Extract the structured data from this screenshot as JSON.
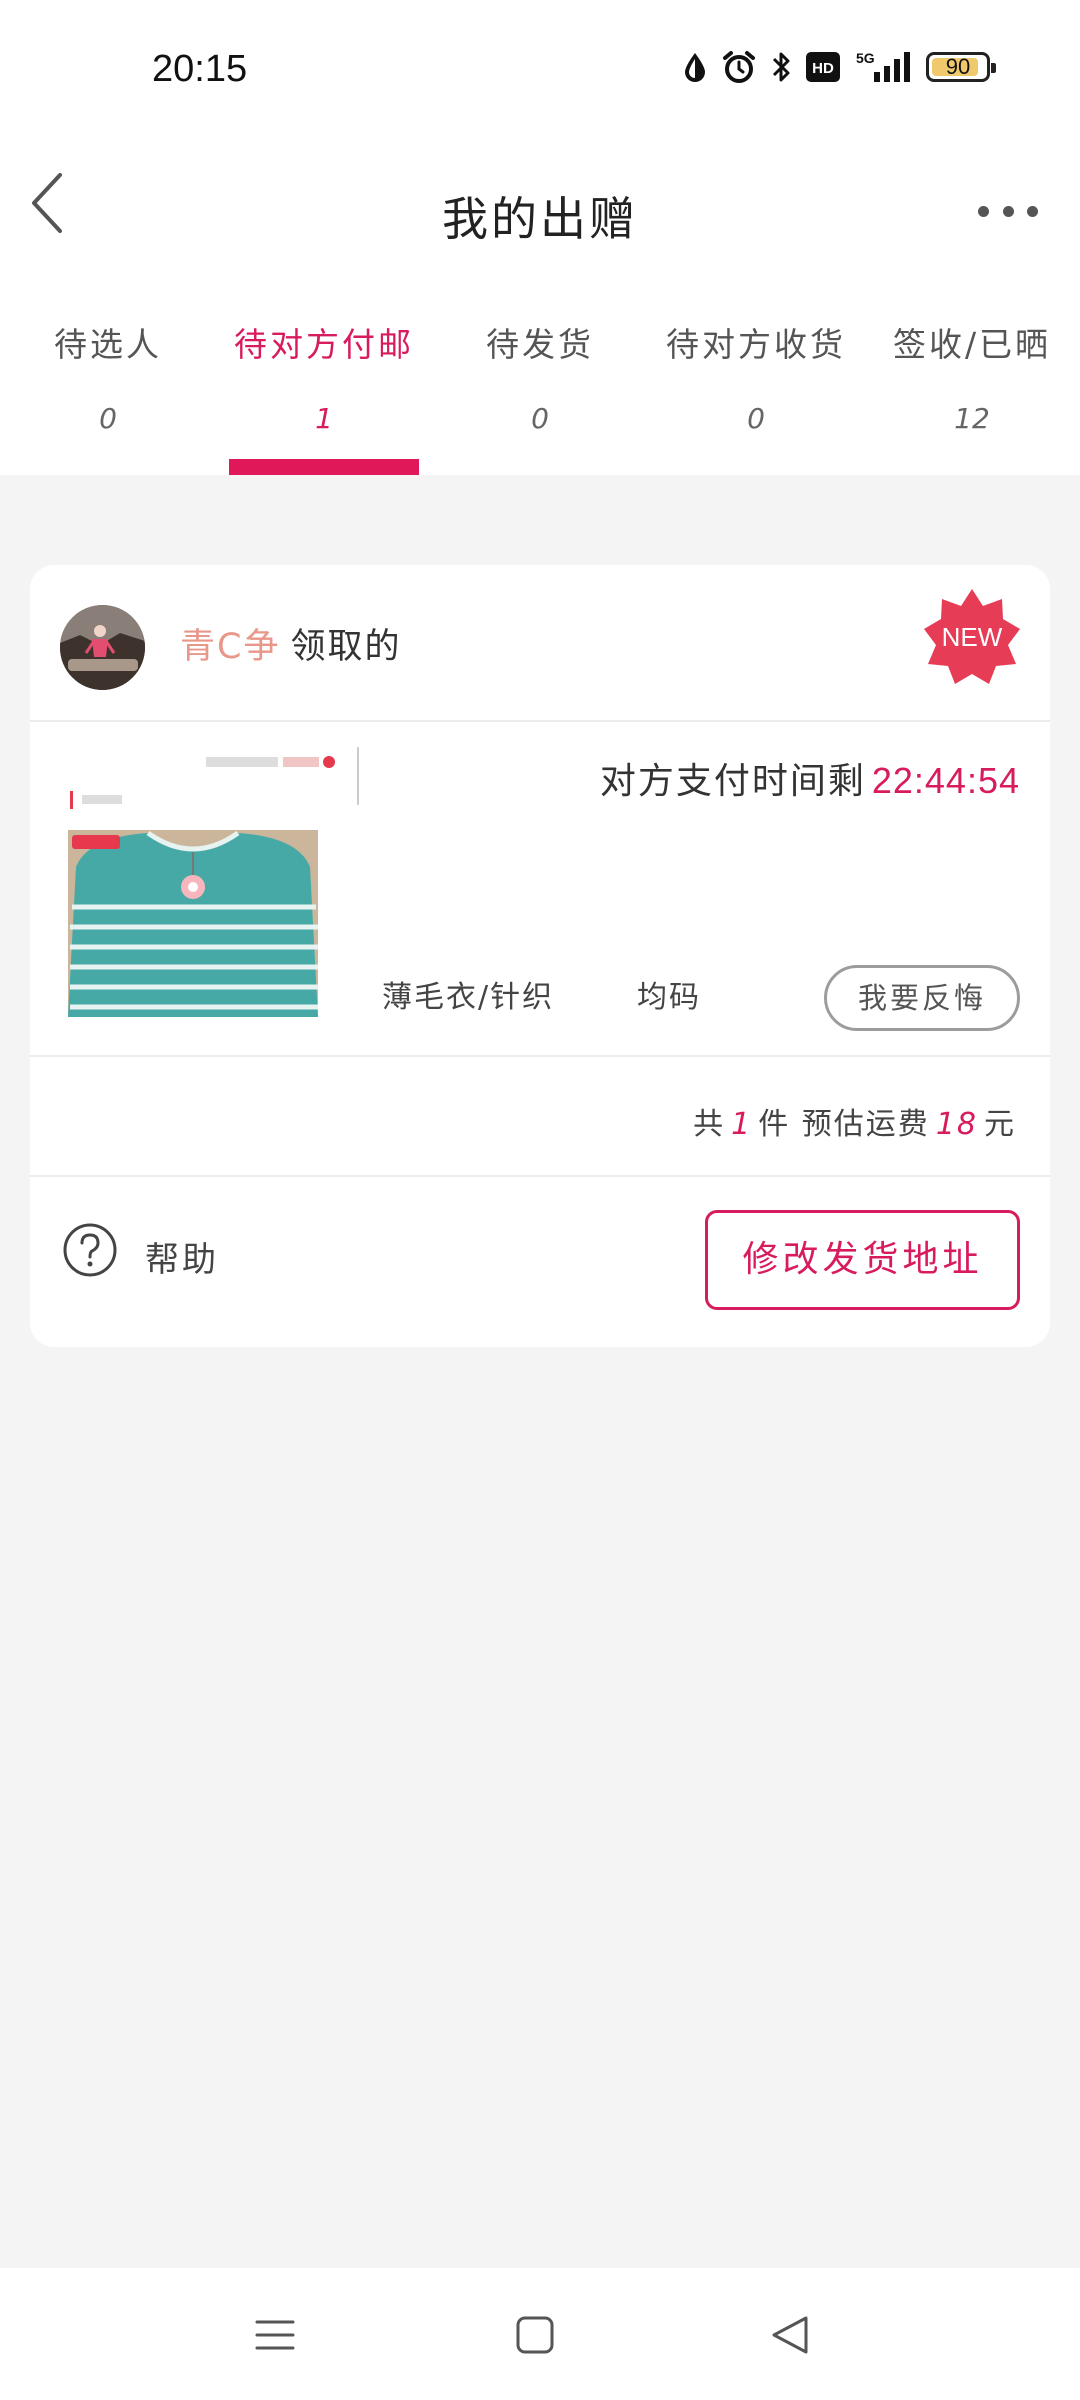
{
  "status_bar": {
    "time": "20:15",
    "network": "5G",
    "hd_label": "HD",
    "battery": "90",
    "battery_level": 0.9,
    "icons": [
      "water-drop-icon",
      "alarm-icon",
      "bluetooth-icon",
      "hd-icon",
      "signal-5g-icon",
      "battery-icon"
    ]
  },
  "header": {
    "title": "我的出赠",
    "back_icon": "chevron-left-icon",
    "more_icon": "more-dots-icon"
  },
  "tabs": [
    {
      "label": "待选人",
      "count": "0",
      "active": false
    },
    {
      "label": "待对方付邮",
      "count": "1",
      "active": true
    },
    {
      "label": "待发货",
      "count": "0",
      "active": false
    },
    {
      "label": "待对方收货",
      "count": "0",
      "active": false
    },
    {
      "label": "签收/已晒",
      "count": "12",
      "active": false
    }
  ],
  "card": {
    "user": {
      "name": "青C争",
      "suffix": "领取的",
      "badge": "NEW"
    },
    "product": {
      "timer_label": "对方支付时间剩",
      "timer_value": "22:44:54",
      "category": "薄毛衣/针织",
      "size": "均码",
      "regret_button": "我要反悔"
    },
    "summary": {
      "prefix": "共",
      "count": "1",
      "middle": "件 预估运费",
      "fee": "18",
      "unit": "元"
    },
    "footer": {
      "help_label": "帮助",
      "address_button": "修改发货地址"
    }
  },
  "colors": {
    "accent": "#d81b5e",
    "tab_underline": "#e0185a",
    "user_name": "#e8978a",
    "background": "#f4f4f4"
  },
  "nav": {
    "icons": [
      "menu-icon",
      "home-square-icon",
      "back-triangle-icon"
    ]
  }
}
